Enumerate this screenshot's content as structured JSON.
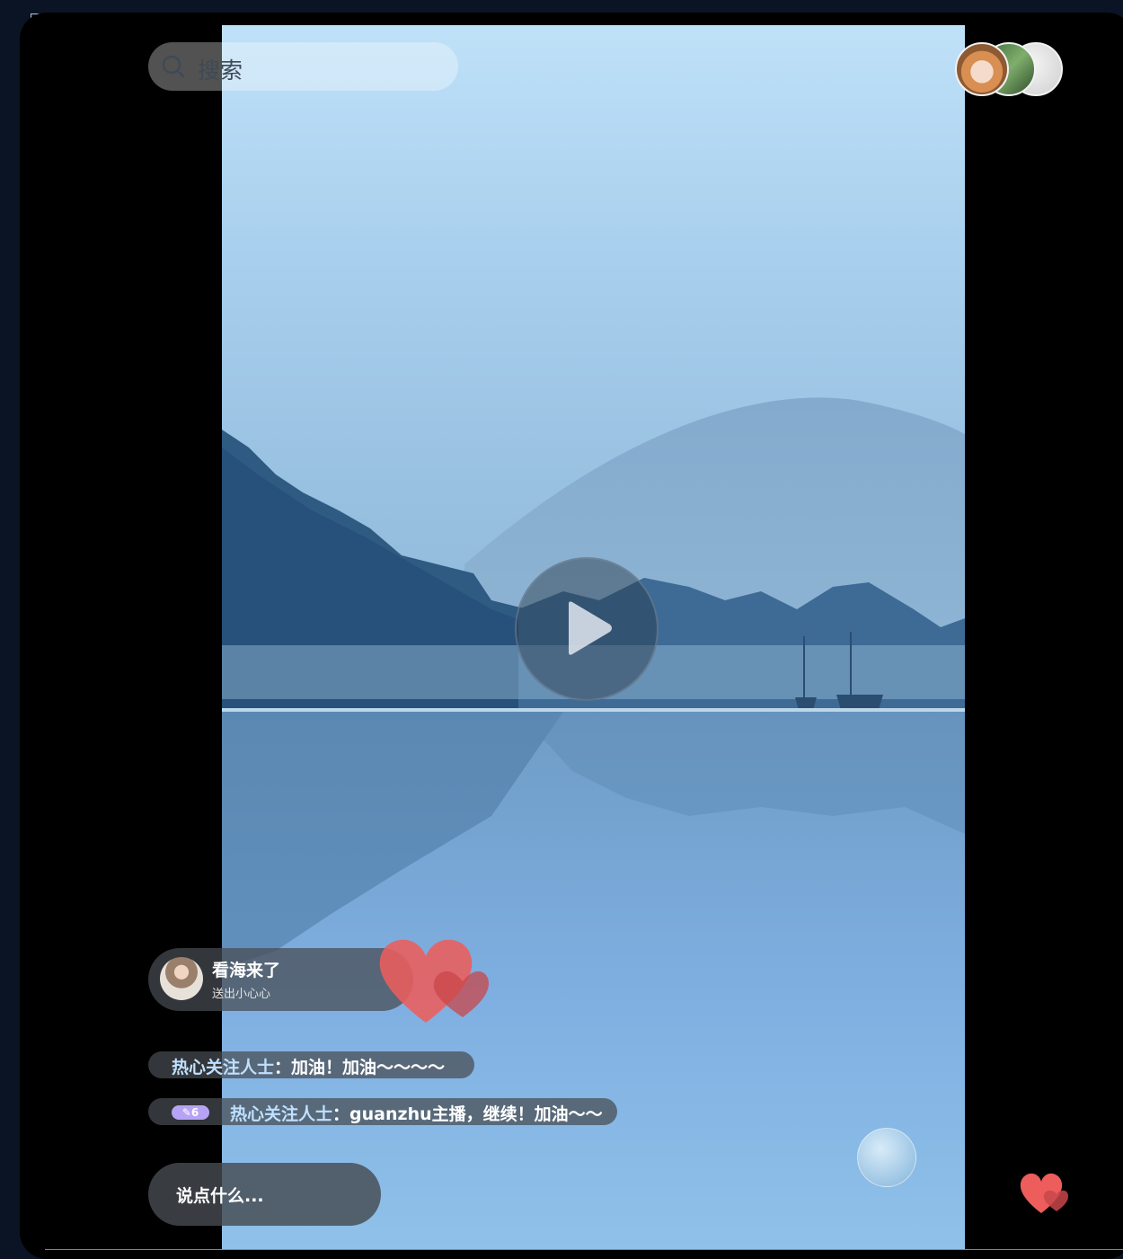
{
  "search": {
    "placeholder": "搜索"
  },
  "viewers": {
    "avatars": [
      "corgi-avatar",
      "forest-avatar",
      "blank-avatar"
    ]
  },
  "video": {
    "state": "paused"
  },
  "gift_notice": {
    "user": "看海来了",
    "action": "送出小心心"
  },
  "comments": [
    {
      "user": "热心关注人士",
      "separator": "：",
      "message": "加油！加油～～～～"
    },
    {
      "level": "6",
      "user": "热心关注人士",
      "separator": "：",
      "message": "guanzhu主播，继续！加油～～"
    }
  ],
  "chat_input": {
    "placeholder": "说点什么..."
  },
  "colors": {
    "heart": "#ec5d5c",
    "level_badge": "#b7a3f5",
    "comment_user": "#bfe0ff"
  }
}
